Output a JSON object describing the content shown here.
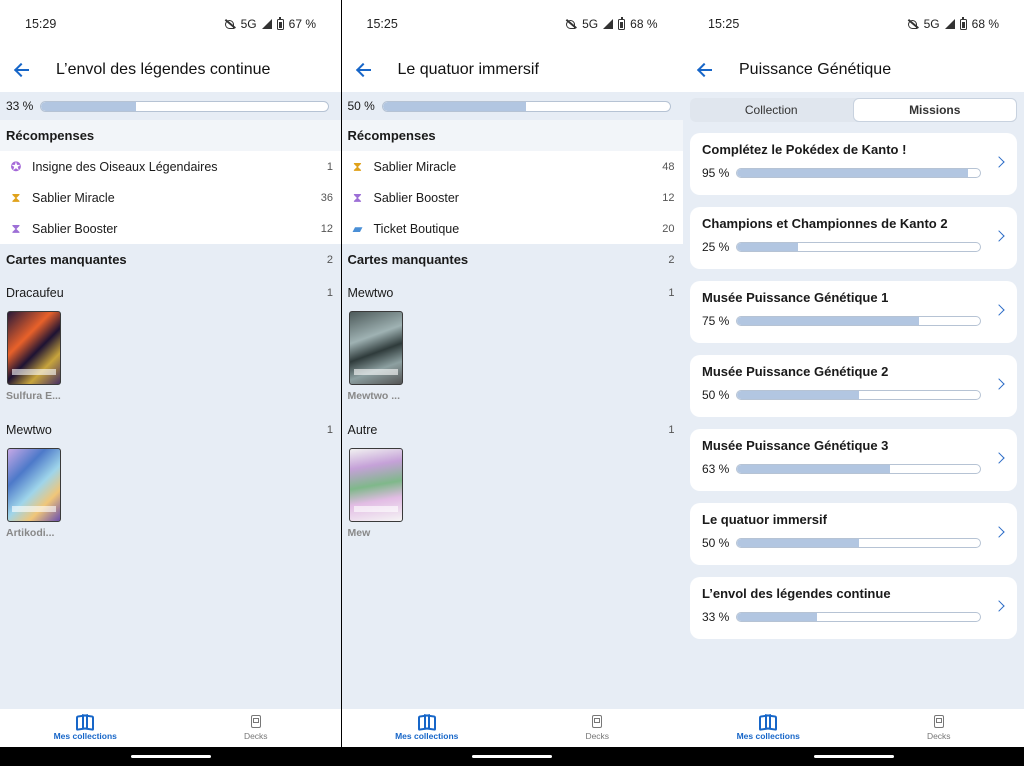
{
  "screens": [
    {
      "status": {
        "time": "15:29",
        "network": "5G",
        "battery": "67 %"
      },
      "title": "L’envol des légendes continue",
      "progress": {
        "label": "33 %",
        "value": 33
      },
      "rewards_title": "Récompenses",
      "rewards": [
        {
          "icon": "badge-icon",
          "label": "Insigne des Oiseaux Légendaires",
          "count": "1"
        },
        {
          "icon": "hourglass-gold-icon",
          "label": "Sablier Miracle",
          "count": "36"
        },
        {
          "icon": "hourglass-purple-icon",
          "label": "Sablier Booster",
          "count": "12"
        }
      ],
      "missing_title": "Cartes manquantes",
      "missing_count": "2",
      "groups": [
        {
          "name": "Dracaufeu",
          "count": "1",
          "card": "Sulfura E..."
        },
        {
          "name": "Mewtwo",
          "count": "1",
          "card": "Artikodi..."
        }
      ]
    },
    {
      "status": {
        "time": "15:25",
        "network": "5G",
        "battery": "68 %"
      },
      "title": "Le quatuor immersif",
      "progress": {
        "label": "50 %",
        "value": 50
      },
      "rewards_title": "Récompenses",
      "rewards": [
        {
          "icon": "hourglass-gold-icon",
          "label": "Sablier Miracle",
          "count": "48"
        },
        {
          "icon": "hourglass-purple-icon",
          "label": "Sablier Booster",
          "count": "12"
        },
        {
          "icon": "ticket-icon",
          "label": "Ticket Boutique",
          "count": "20"
        }
      ],
      "missing_title": "Cartes manquantes",
      "missing_count": "2",
      "groups": [
        {
          "name": "Mewtwo",
          "count": "1",
          "card": "Mewtwo ..."
        },
        {
          "name": "Autre",
          "count": "1",
          "card": "Mew"
        }
      ]
    },
    {
      "status": {
        "time": "15:25",
        "network": "5G",
        "battery": "68 %"
      },
      "title": "Puissance Génétique",
      "tabs": [
        "Collection",
        "Missions"
      ],
      "missions": [
        {
          "title": "Complétez le Pokédex de Kanto !",
          "label": "95 %",
          "value": 95
        },
        {
          "title": "Champions et Championnes de Kanto 2",
          "label": "25 %",
          "value": 25
        },
        {
          "title": "Musée Puissance Génétique 1",
          "label": "75 %",
          "value": 75
        },
        {
          "title": "Musée Puissance Génétique 2",
          "label": "50 %",
          "value": 50
        },
        {
          "title": "Musée Puissance Génétique 3",
          "label": "63 %",
          "value": 63
        },
        {
          "title": "Le quatuor immersif",
          "label": "50 %",
          "value": 50
        },
        {
          "title": "L’envol des légendes continue",
          "label": "33 %",
          "value": 33
        }
      ]
    }
  ],
  "nav": {
    "collections": "Mes collections",
    "decks": "Decks"
  },
  "colors": {
    "accent": "#1766c8",
    "progress_fill": "#b2c6e1",
    "background": "#e7edf5"
  }
}
